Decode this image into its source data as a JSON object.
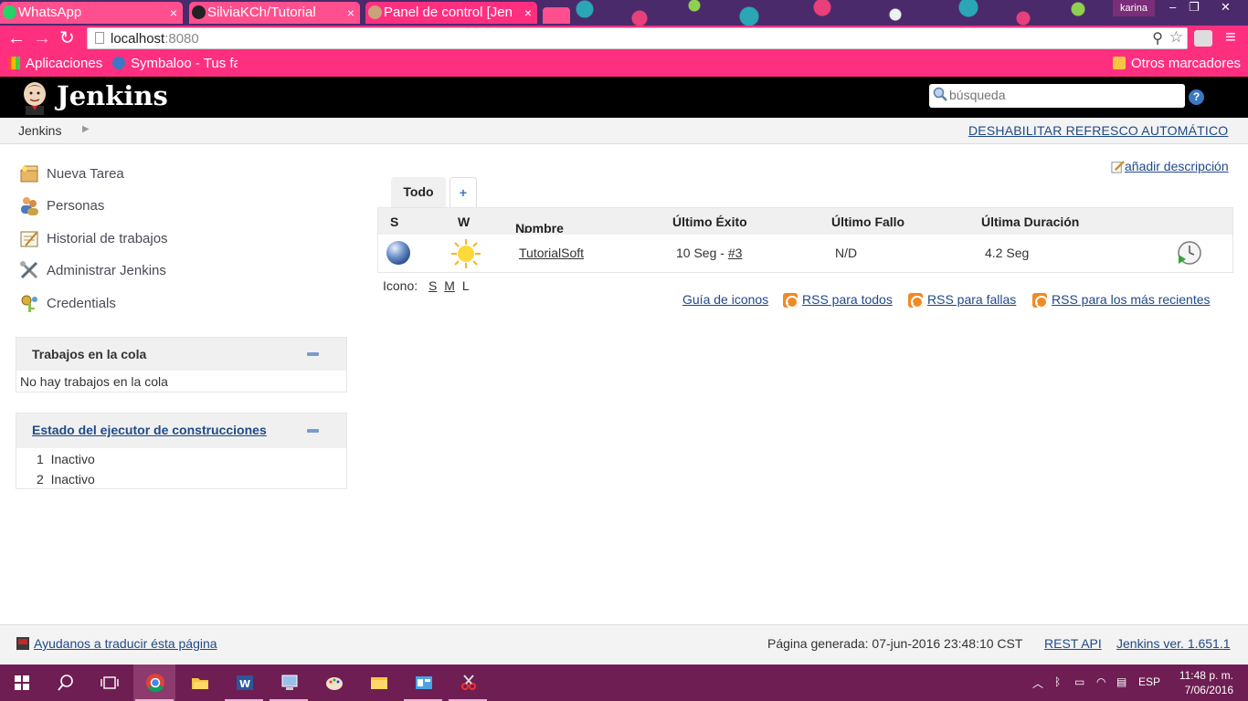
{
  "browser": {
    "tabs": [
      {
        "title": "WhatsApp",
        "close": "×"
      },
      {
        "title": "SilviaKCh/Tutorial",
        "close": "×"
      },
      {
        "title": "Panel de control [Jen",
        "close": "×"
      }
    ],
    "profile_name": "karina",
    "address": {
      "host": "localhost",
      "port": ":8080"
    },
    "bookmarks": {
      "apps": "Aplicaciones",
      "symbaloo": "Symbaloo - Tus fa",
      "other": "Otros marcadores"
    }
  },
  "jenkins": {
    "title": "Jenkins",
    "search": {
      "placeholder": "búsqueda"
    },
    "help": "?",
    "breadcrumb": "Jenkins",
    "disable_autorefresh": "DESHABILITAR REFRESCO AUTOMÁTICO",
    "tasks": [
      {
        "label": "Nueva Tarea",
        "icon": "new-package-icon"
      },
      {
        "label": "Personas",
        "icon": "people-icon"
      },
      {
        "label": "Historial de trabajos",
        "icon": "notepad-icon"
      },
      {
        "label": "Administrar Jenkins",
        "icon": "gear-tools-icon"
      },
      {
        "label": "Credentials",
        "icon": "credentials-icon"
      }
    ],
    "build_queue": {
      "title": "Trabajos en la cola",
      "empty": "No hay trabajos en la cola"
    },
    "executors": {
      "title": "Estado del ejecutor de construcciones",
      "rows": [
        {
          "num": "1",
          "status": "Inactivo"
        },
        {
          "num": "2",
          "status": "Inactivo"
        }
      ]
    },
    "add_description": "añadir descripción",
    "view_tabs": {
      "all": "Todo",
      "add": "+"
    },
    "job_table": {
      "headers": {
        "s": "S",
        "w": "W",
        "name": "Nombre",
        "sort_arrow": "↓",
        "last_success": "Último Éxito",
        "last_failure": "Último Fallo",
        "last_duration": "Última Duración"
      },
      "rows": [
        {
          "name": "TutorialSoft",
          "last_success_time": "10 Seg - ",
          "last_success_build": "#3",
          "last_failure": "N/D",
          "last_duration": "4.2 Seg",
          "status_color": "blue",
          "weather": "sunny"
        }
      ]
    },
    "icon_size": {
      "label": "Icono:",
      "s": "S",
      "m": "M",
      "l": "L"
    },
    "links": {
      "legend": "Guía de iconos",
      "rss_all": "RSS para todos",
      "rss_failed": "RSS para fallas",
      "rss_latest": "RSS para los más recientes"
    },
    "footer": {
      "translate": "Ayudanos a traducir ésta página",
      "generated": "Página generada: 07-jun-2016 23:48:10 CST",
      "rest_api": "REST API",
      "version": "Jenkins ver. 1.651.1"
    }
  },
  "taskbar": {
    "language": "ESP",
    "time": "11:48 p. m.",
    "date": "7/06/2016"
  },
  "colors": {
    "chrome_theme": "#ff2f80",
    "jenkins_header": "#000000",
    "link": "#204a87",
    "taskbar": "#6e1e52"
  }
}
